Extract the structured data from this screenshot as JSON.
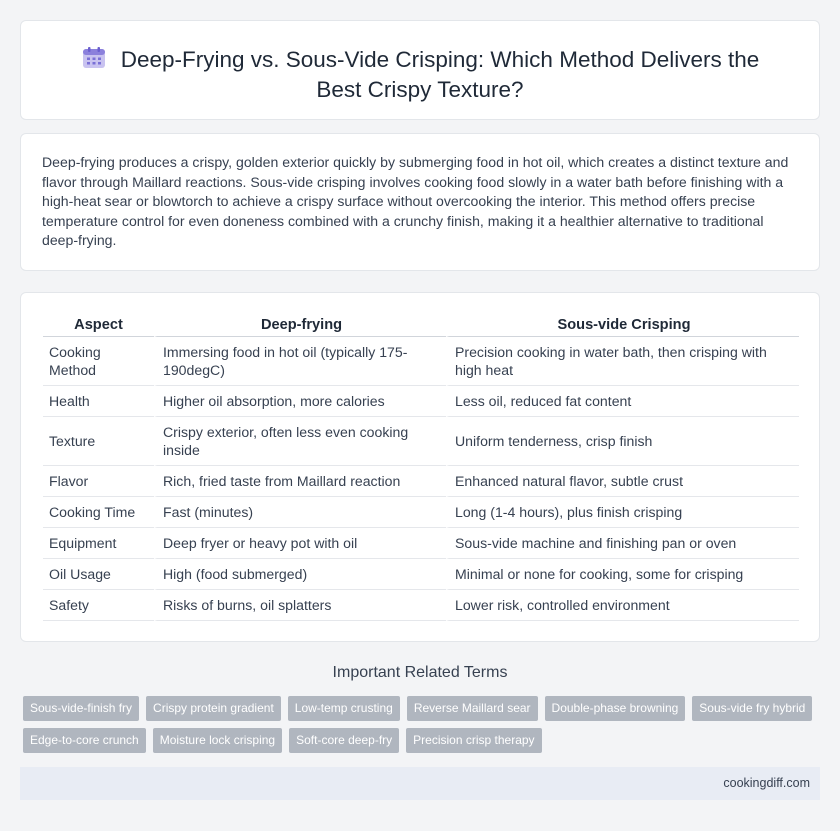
{
  "header": {
    "icon": "calendar-icon",
    "title_line1": "Deep-Frying vs. Sous-Vide Crisping: Which Method Delivers the",
    "title_line2": "Best Crispy Texture?"
  },
  "intro": {
    "text": "Deep-frying produces a crispy, golden exterior quickly by submerging food in hot oil, which creates a distinct texture and flavor through Maillard reactions. Sous-vide crisping involves cooking food slowly in a water bath before finishing with a high-heat sear or blowtorch to achieve a crispy surface without overcooking the interior. This method offers precise temperature control for even doneness combined with a crunchy finish, making it a healthier alternative to traditional deep-frying."
  },
  "table": {
    "headers": [
      "Aspect",
      "Deep-frying",
      "Sous-vide Crisping"
    ],
    "rows": [
      [
        "Cooking Method",
        "Immersing food in hot oil (typically 175-190degC)",
        "Precision cooking in water bath, then crisping with high heat"
      ],
      [
        "Health",
        "Higher oil absorption, more calories",
        "Less oil, reduced fat content"
      ],
      [
        "Texture",
        "Crispy exterior, often less even cooking inside",
        "Uniform tenderness, crisp finish"
      ],
      [
        "Flavor",
        "Rich, fried taste from Maillard reaction",
        "Enhanced natural flavor, subtle crust"
      ],
      [
        "Cooking Time",
        "Fast (minutes)",
        "Long (1-4 hours), plus finish crisping"
      ],
      [
        "Equipment",
        "Deep fryer or heavy pot with oil",
        "Sous-vide machine and finishing pan or oven"
      ],
      [
        "Oil Usage",
        "High (food submerged)",
        "Minimal or none for cooking, some for crisping"
      ],
      [
        "Safety",
        "Risks of burns, oil splatters",
        "Lower risk, controlled environment"
      ]
    ]
  },
  "related": {
    "title": "Important Related Terms",
    "tags_row1": [
      "Sous-vide-finish fry",
      "Crispy protein gradient",
      "Low-temp crusting",
      "Reverse Maillard sear",
      "Double-phase browning",
      "Sous-vide fry hybrid"
    ],
    "tags_row2": [
      "Edge-to-core crunch",
      "Moisture lock crisping",
      "Soft-core deep-fry",
      "Precision crisp therapy"
    ]
  },
  "footer": {
    "site": "cookingdiff.com"
  },
  "colors": {
    "tag_bg": "#b0b6bf",
    "footer_bg": "#e8ecf4",
    "page_bg": "#f3f4f6"
  }
}
